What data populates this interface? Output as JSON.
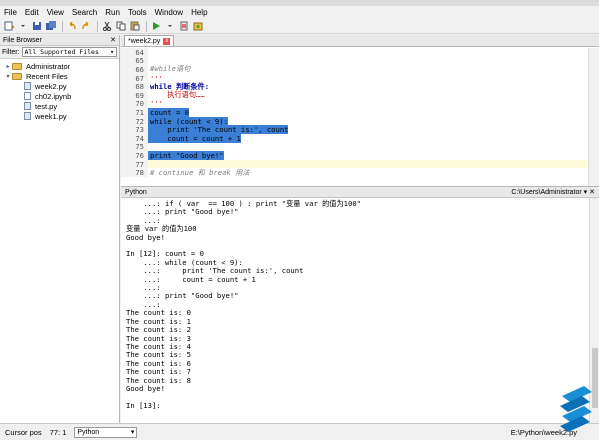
{
  "menu": [
    "File",
    "Edit",
    "View",
    "Search",
    "Run",
    "Tools",
    "Window",
    "Help"
  ],
  "file_browser": {
    "title": "File Browser",
    "filter_label": "Filter:",
    "filter_value": "All Supported Files",
    "tree": [
      {
        "label": "Administrator",
        "type": "folder",
        "level": 0
      },
      {
        "label": "Recent Files",
        "type": "folder",
        "level": 0
      },
      {
        "label": "week2.py",
        "type": "py",
        "level": 1
      },
      {
        "label": "ch02.ipynb",
        "type": "nb",
        "level": 1
      },
      {
        "label": "test.py",
        "type": "py",
        "level": 1
      },
      {
        "label": "week1.py",
        "type": "py",
        "level": 1
      }
    ]
  },
  "editor": {
    "tab": "*week2.py",
    "lines": [
      {
        "n": "64",
        "t": ""
      },
      {
        "n": "65",
        "t": ""
      },
      {
        "n": "66",
        "t": "#while语句",
        "c": "cm"
      },
      {
        "n": "67",
        "t": "'''",
        "c": "st"
      },
      {
        "n": "68",
        "t": "while 判断条件:",
        "c": "st"
      },
      {
        "n": "69",
        "t": "    执行语句……",
        "c": "st"
      },
      {
        "n": "70",
        "t": "'''",
        "c": "st"
      },
      {
        "n": "71",
        "t": "count = 0",
        "sel": true
      },
      {
        "n": "72",
        "t": "while (count < 9):",
        "sel": true
      },
      {
        "n": "73",
        "t": "    print 'The count is:', count",
        "sel": true
      },
      {
        "n": "74",
        "t": "    count = count + 1",
        "sel": true
      },
      {
        "n": "75",
        "t": "",
        "sel": true
      },
      {
        "n": "76",
        "t": "print \"Good bye!\"",
        "sel": true
      },
      {
        "n": "77",
        "t": "",
        "hl": true
      },
      {
        "n": "78",
        "t": "# continue 和 break 用法",
        "c": "cm"
      }
    ]
  },
  "console": {
    "title": "Python",
    "path": "C:\\Users\\Administrator",
    "lines": [
      "    ...: if ( var  == 100 ) : print \"变量 var 的值为100\"",
      "    ...: print \"Good bye!\"",
      "    ...:",
      "变量 var 的值为100",
      "Good bye!",
      "",
      "In [12]: count = 0",
      "    ...: while (count < 9):",
      "    ...:     print 'The count is:', count",
      "    ...:     count = count + 1",
      "    ...:",
      "    ...: print \"Good bye!\"",
      "    ...:",
      "The count is: 0",
      "The count is: 1",
      "The count is: 2",
      "The count is: 3",
      "The count is: 4",
      "The count is: 5",
      "The count is: 6",
      "The count is: 7",
      "The count is: 8",
      "Good bye!",
      "",
      "In [13]:"
    ]
  },
  "status": {
    "cursor_label": "Cursor pos",
    "cursor_value": "77: 1",
    "language": "Python",
    "path": "E:\\Python\\week2.py"
  }
}
